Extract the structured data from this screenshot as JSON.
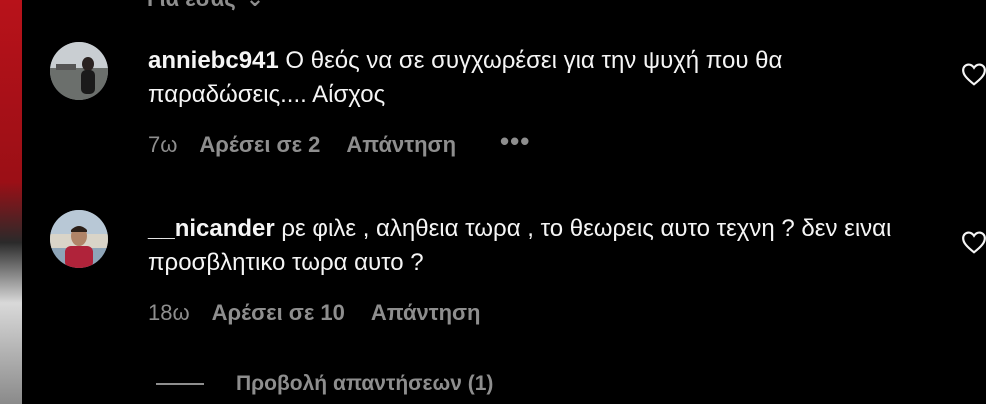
{
  "top_partial": {
    "text": "Για εσάς",
    "chevron": "chevron-down-icon"
  },
  "comments": [
    {
      "username": "anniebc941",
      "text": "Ο θεός να σε συγχωρέσει για την ψυχή που θα παραδώσεις.... Αίσχος",
      "time": "7ω",
      "likes": "Αρέσει σε 2",
      "reply": "Απάντηση",
      "more": "•••",
      "heart_icon": "heart-outline-icon"
    },
    {
      "username": "__nicander",
      "text": "ρε φιλε , αληθεια τωρα , το θεωρεις αυτο τεχνη ? δεν ειναι προσβλητικο τωρα αυτο ?",
      "time": "18ω",
      "likes": "Αρέσει σε 10",
      "reply": "Απάντηση",
      "heart_icon": "heart-outline-icon"
    }
  ],
  "view_replies": "Προβολή απαντήσεων (1)",
  "colors": {
    "background": "#000000",
    "text": "#f5f5f5",
    "secondary": "#8e8e8e"
  }
}
